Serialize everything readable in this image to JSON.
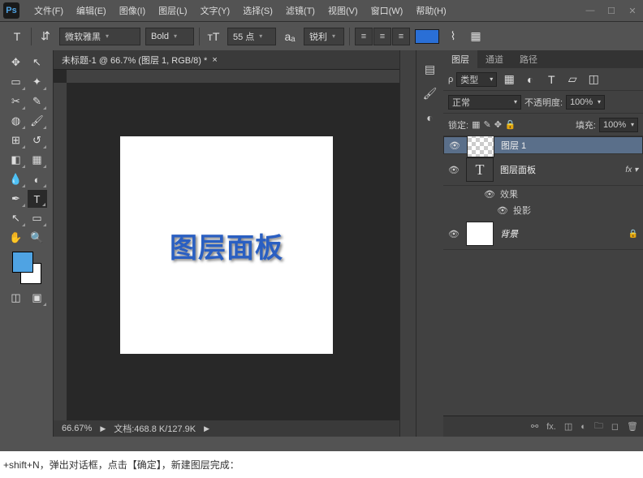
{
  "menu": {
    "items": [
      "文件(F)",
      "编辑(E)",
      "图像(I)",
      "图层(L)",
      "文字(Y)",
      "选择(S)",
      "滤镜(T)",
      "视图(V)",
      "窗口(W)",
      "帮助(H)"
    ],
    "logo": "Ps"
  },
  "optbar": {
    "font": "微软雅黑",
    "weight": "Bold",
    "size": "55 点",
    "aa": "锐利"
  },
  "doc": {
    "tab": "未标题-1 @ 66.7% (图层 1, RGB/8) *",
    "canvas_text": "图层面板",
    "zoom": "66.67%",
    "docinfo": "文档:468.8 K/127.9K"
  },
  "layerspanel": {
    "tabs": [
      "图层",
      "通道",
      "路径"
    ],
    "kind": "类型",
    "blend": "正常",
    "opacity_label": "不透明度:",
    "opacity": "100%",
    "lock_label": "锁定:",
    "fill_label": "填充:",
    "fill": "100%",
    "layers": [
      {
        "name": "图层 1",
        "thumb": "checker",
        "sel": true
      },
      {
        "name": "图层面板",
        "thumb": "T",
        "fx": true
      },
      {
        "name": "背景",
        "thumb": "white",
        "locked": true
      }
    ],
    "effects_label": "效果",
    "shadow_label": "投影"
  },
  "bottom": "+shift+N，弹出对话框，点击【确定】，新建图层完成："
}
